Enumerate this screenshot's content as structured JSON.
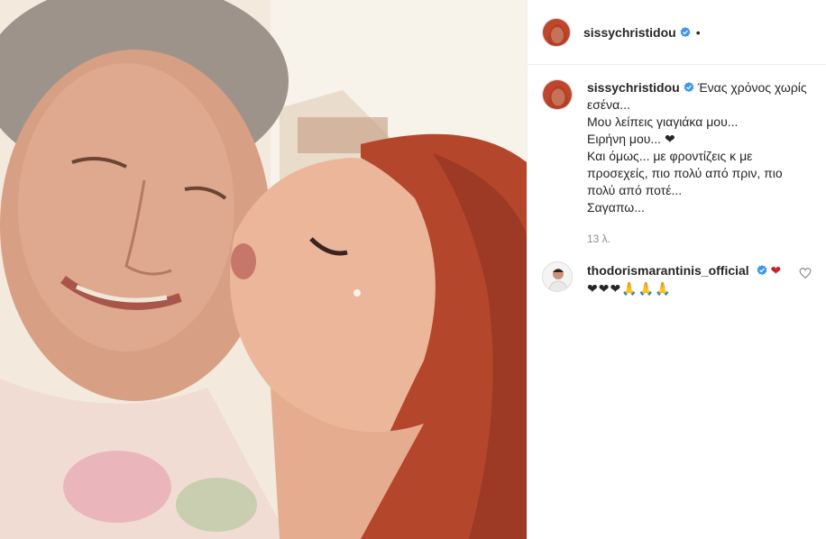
{
  "post": {
    "author": {
      "username": "sissychristidou",
      "verified": true,
      "menu_dot": "•"
    },
    "caption": {
      "username": "sissychristidou",
      "lines": [
        "Ένας χρόνος χωρίς εσένα...",
        "Μου λείπεις γιαγιάκα μου...",
        "Ειρήνη μου... ❤",
        "Και όμως... με φροντίζεις κ με προσεχείς, πιο πολύ από πριν, πιο πολύ από ποτέ...",
        "Σαγαπω..."
      ],
      "time": "13 λ."
    },
    "comments": [
      {
        "username": "thodorismarantinis_official",
        "verified": true,
        "text_line1": "❤",
        "text_line2": "❤❤❤🙏🙏🙏"
      }
    ]
  },
  "icons": {
    "verified": "verified-badge-icon",
    "like": "heart-outline-icon"
  },
  "colors": {
    "verified_blue": "#3897f0",
    "heart_red": "#d01f2b",
    "muted_text": "#8e8e8e",
    "divider": "#efefef"
  }
}
